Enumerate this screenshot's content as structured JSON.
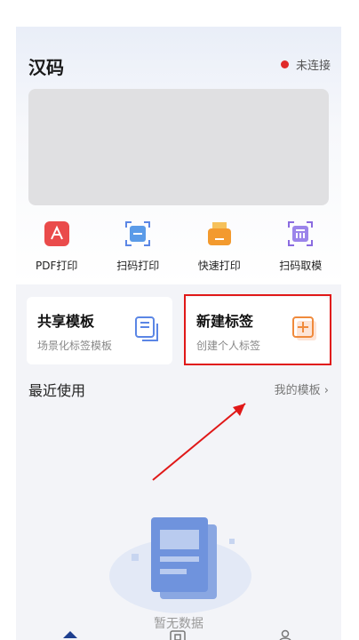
{
  "header": {
    "title": "汉码",
    "status_text": "未连接",
    "status_color": "#e02a2a"
  },
  "quick_actions": [
    {
      "label": "PDF打印",
      "icon": "pdf-icon"
    },
    {
      "label": "扫码打印",
      "icon": "scan-print-icon"
    },
    {
      "label": "快速打印",
      "icon": "printer-icon"
    },
    {
      "label": "扫码取模",
      "icon": "scan-template-icon"
    }
  ],
  "cards": {
    "shared": {
      "title": "共享模板",
      "subtitle": "场景化标签模板",
      "icon": "template-stack-icon"
    },
    "new_label": {
      "title": "新建标签",
      "subtitle": "创建个人标签",
      "icon": "add-label-icon"
    }
  },
  "recent": {
    "title": "最近使用",
    "more_label": "我的模板",
    "empty_text": "暂无数据"
  },
  "colors": {
    "accent_blue": "#5b86e5",
    "accent_orange": "#f08a3c",
    "highlight_red": "#e01818"
  }
}
